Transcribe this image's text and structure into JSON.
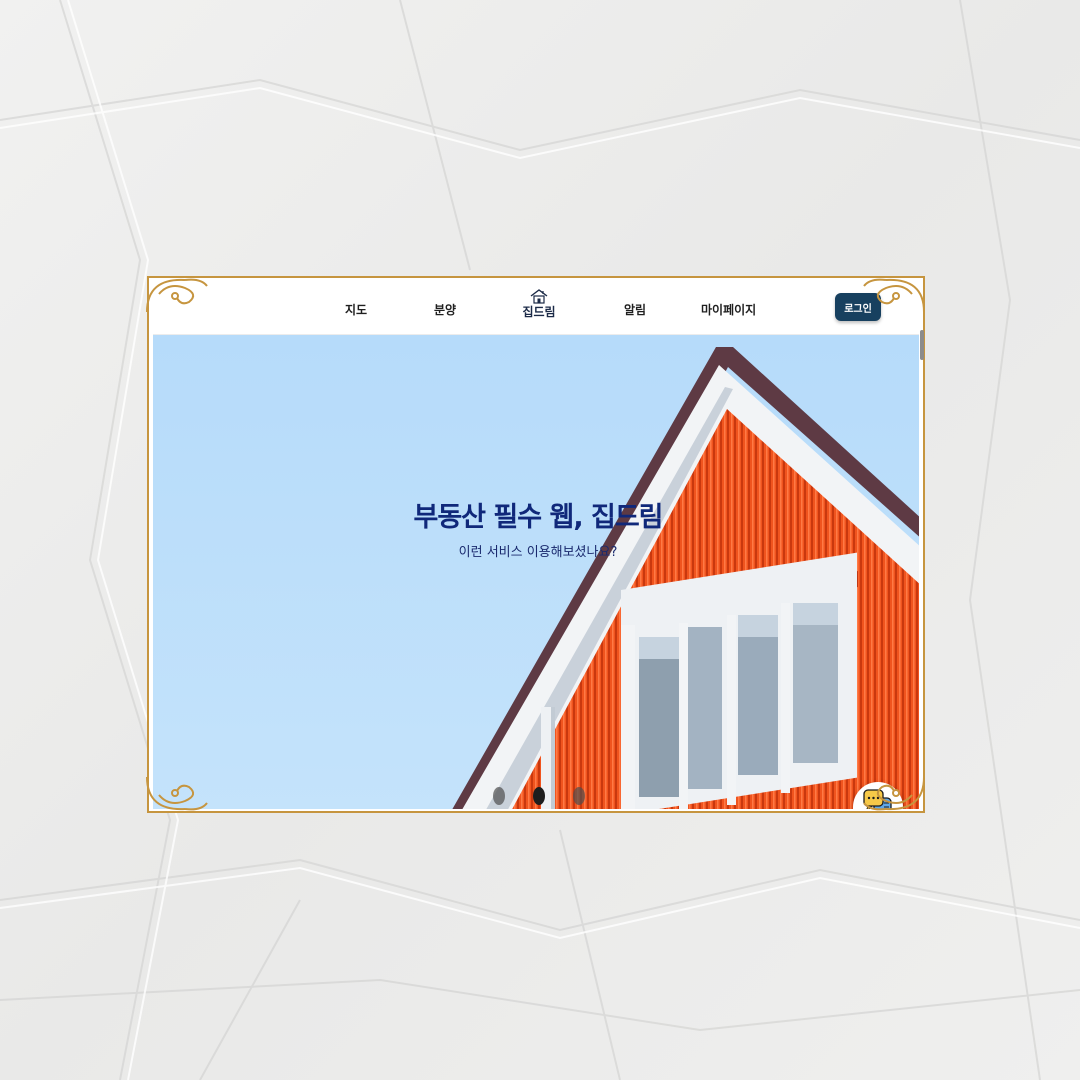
{
  "nav": {
    "items": [
      "지도",
      "분양",
      "알림",
      "마이페이지"
    ],
    "logo_text": "집드림",
    "logo_icon": "house-logo-icon",
    "login_label": "로그인"
  },
  "hero": {
    "title": "부동산 필수 웹, 집드림",
    "subtitle": "이런 서비스 이용해보셨나요?"
  },
  "chat": {
    "label": "채팅",
    "icon": "chat-bubbles-icon"
  },
  "colors": {
    "frame_gold": "#c6953f",
    "sky": "#bde0fb",
    "title_navy": "#10287a",
    "login_bg": "#17405f",
    "house_orange": "#f0541e"
  },
  "carousel": {
    "slides": 3,
    "active": 1
  }
}
